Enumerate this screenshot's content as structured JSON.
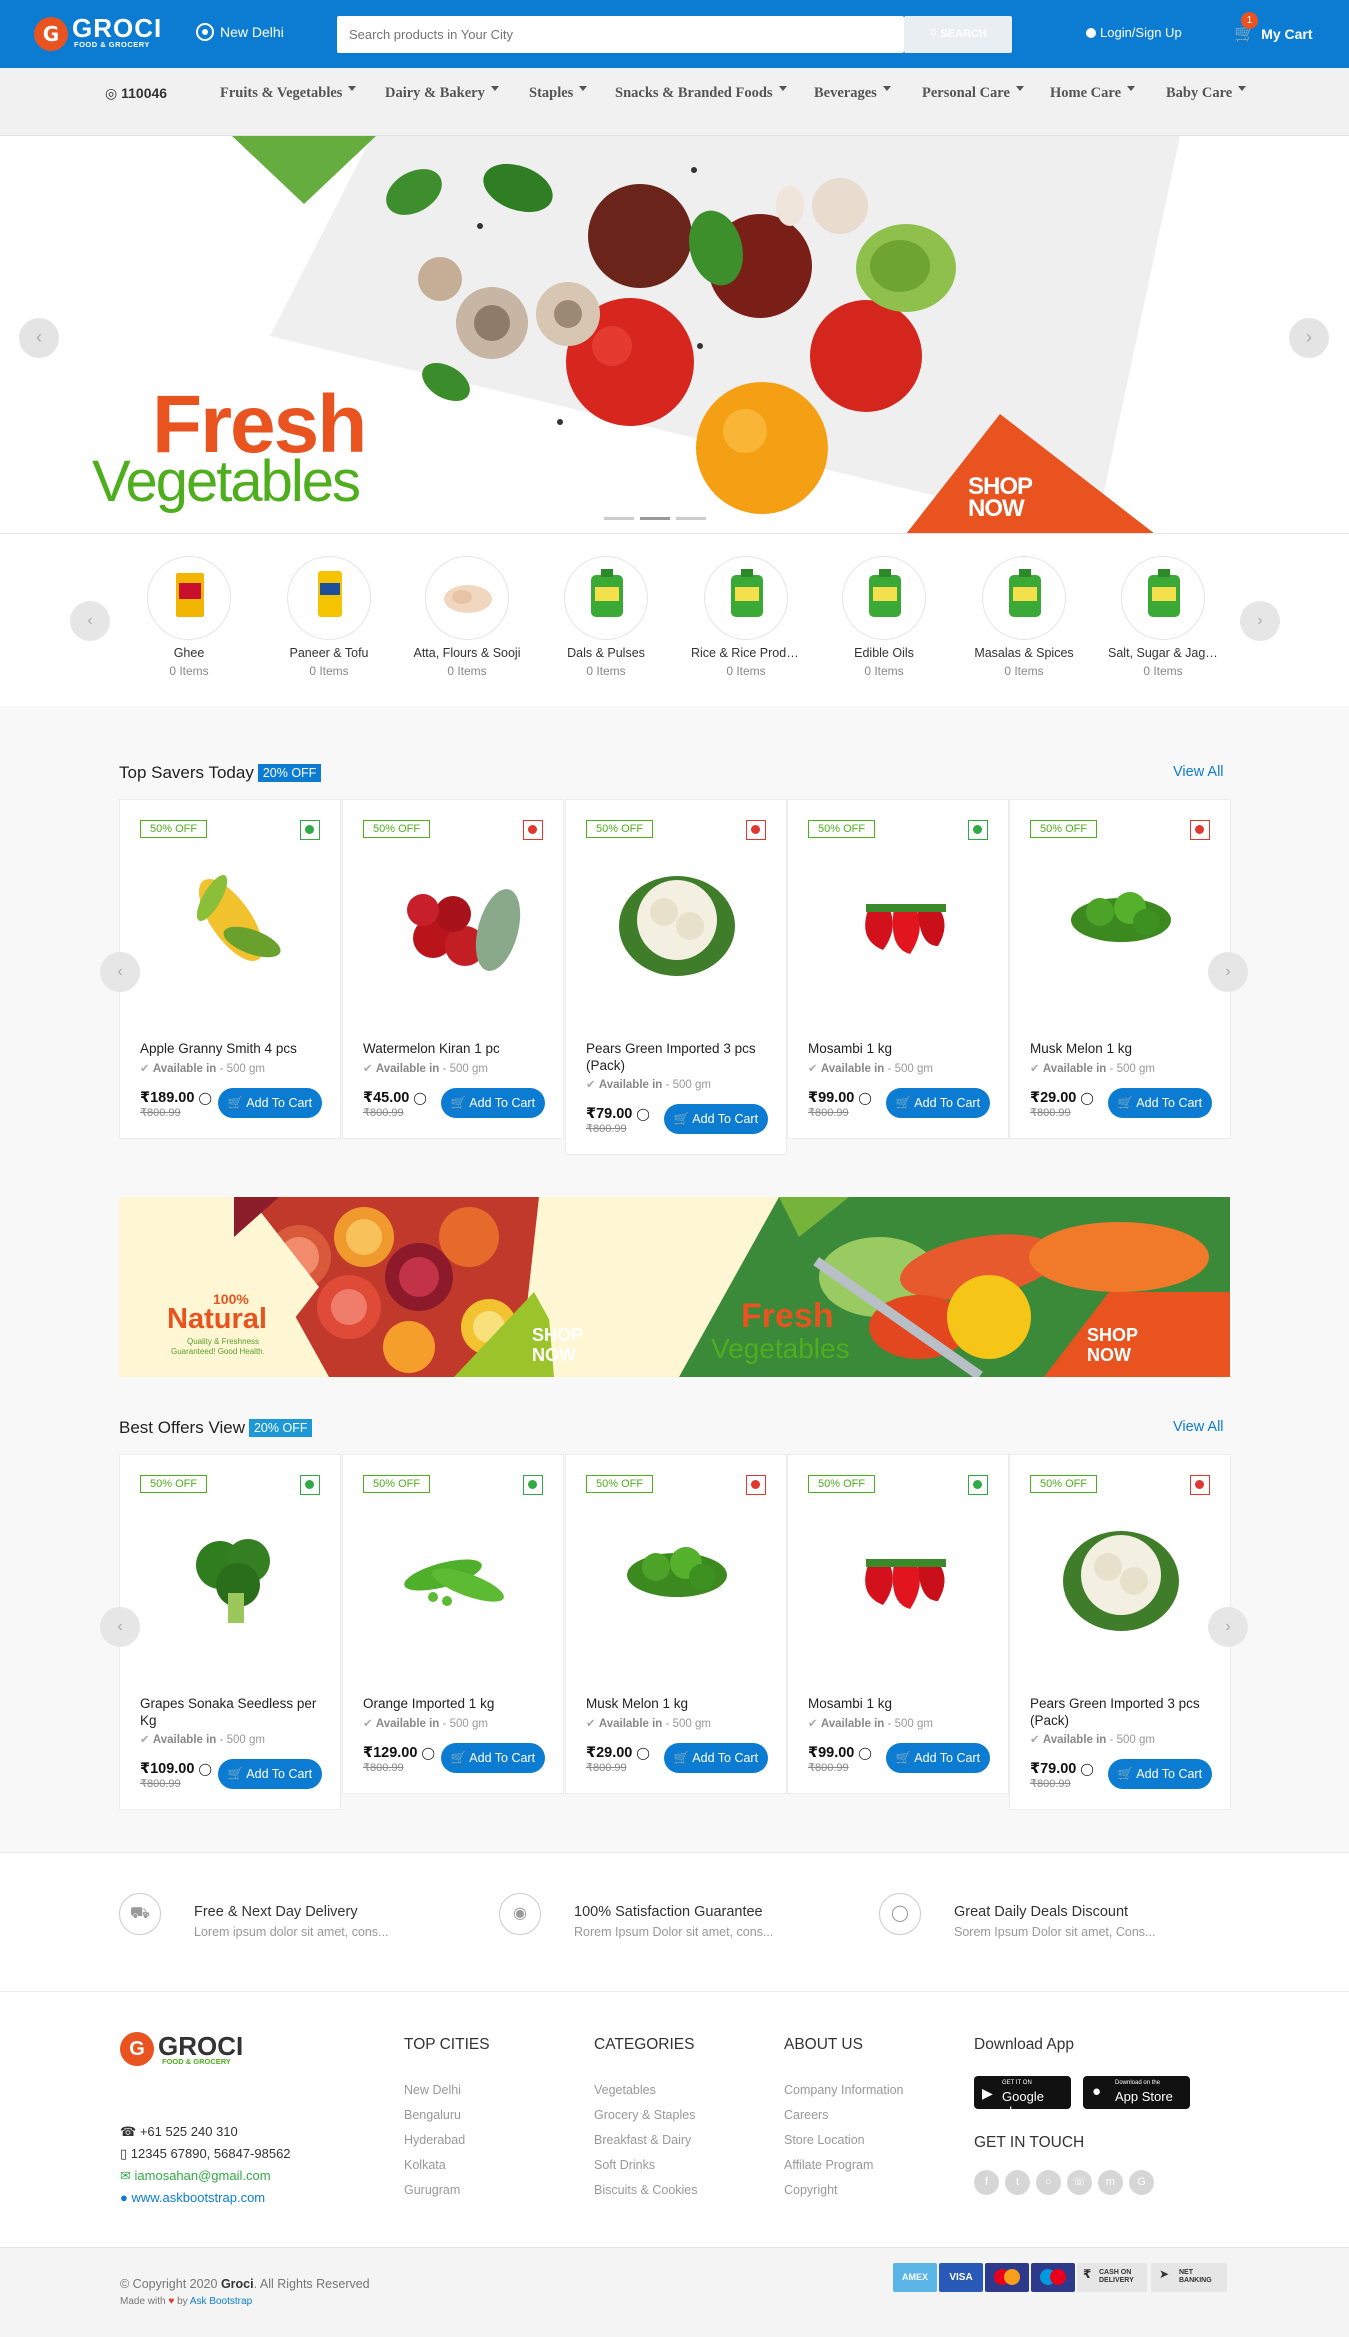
{
  "header": {
    "logo_letter": "G",
    "logo_name": "GROCI",
    "logo_tagline": "FOOD & GROCERY",
    "location": "New Delhi",
    "search_placeholder": "Search products in Your City",
    "search_button": "SEARCH",
    "login": "Login/Sign Up",
    "cart_label": "My Cart",
    "cart_count": "1",
    "brand_color": "#0c7cd3",
    "accent_color": "#e8531f"
  },
  "nav": {
    "pincode": "110046",
    "items": [
      "Fruits & Vegetables",
      "Dairy & Bakery",
      "Staples",
      "Snacks & Branded Foods",
      "Beverages",
      "Personal Care",
      "Home Care",
      "Baby Care"
    ]
  },
  "hero": {
    "title_line1": "Fresh",
    "title_line2": "Vegetables",
    "cta_line1": "SHOP",
    "cta_line2": "NOW",
    "prev_icon": "chevron-left-icon",
    "next_icon": "chevron-right-icon"
  },
  "categories": [
    {
      "name": "Ghee",
      "count": "0 Items"
    },
    {
      "name": "Paneer & Tofu",
      "count": "0 Items"
    },
    {
      "name": "Atta, Flours & Sooji",
      "count": "0 Items"
    },
    {
      "name": "Dals & Pulses",
      "count": "0 Items"
    },
    {
      "name": "Rice & Rice Produ...",
      "count": "0 Items"
    },
    {
      "name": "Edible Oils",
      "count": "0 Items"
    },
    {
      "name": "Masalas & Spices",
      "count": "0 Items"
    },
    {
      "name": "Salt, Sugar & Jagg...",
      "count": "0 Items"
    }
  ],
  "top_savers": {
    "title": "Top Savers Today",
    "badge": "20% OFF",
    "view_all": "View All",
    "products": [
      {
        "discount": "50% OFF",
        "name": "Apple Granny Smith 4 pcs",
        "avail_label": "Available in",
        "avail_value": "- 500 gm",
        "price": "₹189.00",
        "mrp": "₹800.99",
        "cta": "Add To Cart",
        "veg": true
      },
      {
        "discount": "50% OFF",
        "name": "Watermelon Kiran 1 pc",
        "avail_label": "Available in",
        "avail_value": "- 500 gm",
        "price": "₹45.00",
        "mrp": "₹800.99",
        "cta": "Add To Cart",
        "veg": false
      },
      {
        "discount": "50% OFF",
        "name": "Pears Green Imported 3 pcs (Pack)",
        "avail_label": "Available in",
        "avail_value": "- 500 gm",
        "price": "₹79.00",
        "mrp": "₹800.99",
        "cta": "Add To Cart",
        "veg": false
      },
      {
        "discount": "50% OFF",
        "name": "Mosambi 1 kg",
        "avail_label": "Available in",
        "avail_value": "- 500 gm",
        "price": "₹99.00",
        "mrp": "₹800.99",
        "cta": "Add To Cart",
        "veg": true
      },
      {
        "discount": "50% OFF",
        "name": "Musk Melon 1 kg",
        "avail_label": "Available in",
        "avail_value": "- 500 gm",
        "price": "₹29.00",
        "mrp": "₹800.99",
        "cta": "Add To Cart",
        "veg": false
      }
    ]
  },
  "promo": {
    "natural_pct": "100%",
    "natural": "Natural",
    "natural_sub1": "Quality & Freshness",
    "natural_sub2": "Guaranteed! Good Health.",
    "shop1_a": "SHOP",
    "shop1_b": "NOW",
    "fresh": "Fresh",
    "vegetables": "Vegetables",
    "shop2_a": "SHOP",
    "shop2_b": "NOW"
  },
  "best_offers": {
    "title": "Best Offers View",
    "badge": "20% OFF",
    "view_all": "View All",
    "products": [
      {
        "discount": "50% OFF",
        "name": "Grapes Sonaka Seedless per Kg",
        "avail_label": "Available in",
        "avail_value": "- 500 gm",
        "price": "₹109.00",
        "mrp": "₹800.99",
        "cta": "Add To Cart",
        "veg": true
      },
      {
        "discount": "50% OFF",
        "name": "Orange Imported 1 kg",
        "avail_label": "Available in",
        "avail_value": "- 500 gm",
        "price": "₹129.00",
        "mrp": "₹800.99",
        "cta": "Add To Cart",
        "veg": true
      },
      {
        "discount": "50% OFF",
        "name": "Musk Melon 1 kg",
        "avail_label": "Available in",
        "avail_value": "- 500 gm",
        "price": "₹29.00",
        "mrp": "₹800.99",
        "cta": "Add To Cart",
        "veg": false
      },
      {
        "discount": "50% OFF",
        "name": "Mosambi 1 kg",
        "avail_label": "Available in",
        "avail_value": "- 500 gm",
        "price": "₹99.00",
        "mrp": "₹800.99",
        "cta": "Add To Cart",
        "veg": true
      },
      {
        "discount": "50% OFF",
        "name": "Pears Green Imported 3 pcs (Pack)",
        "avail_label": "Available in",
        "avail_value": "- 500 gm",
        "price": "₹79.00",
        "mrp": "₹800.99",
        "cta": "Add To Cart",
        "veg": false
      }
    ]
  },
  "features": [
    {
      "title": "Free & Next Day Delivery",
      "sub": "Lorem ipsum dolor sit amet, cons...",
      "icon": "truck-icon"
    },
    {
      "title": "100% Satisfaction Guarantee",
      "sub": "Rorem Ipsum Dolor sit amet, cons...",
      "icon": "basket-icon"
    },
    {
      "title": "Great Daily Deals Discount",
      "sub": "Sorem Ipsum Dolor sit amet, Cons...",
      "icon": "tag-icon"
    }
  ],
  "footer": {
    "phone1": "+61 525 240 310",
    "phone2": "12345 67890, 56847-98562",
    "email": "iamosahan@gmail.com",
    "website": "www.askbootstrap.com",
    "cities_title": "TOP CITIES",
    "cities": [
      "New Delhi",
      "Bengaluru",
      "Hyderabad",
      "Kolkata",
      "Gurugram"
    ],
    "categories_title": "CATEGORIES",
    "categories": [
      "Vegetables",
      "Grocery & Staples",
      "Breakfast & Dairy",
      "Soft Drinks",
      "Biscuits & Cookies"
    ],
    "about_title": "ABOUT US",
    "about": [
      "Company Information",
      "Careers",
      "Store Location",
      "Affilate Program",
      "Copyright"
    ],
    "app_title": "Download App",
    "google_small": "GET IT ON",
    "google_big": "Google play",
    "apple_small": "Download on the",
    "apple_big": "App Store",
    "touch_title": "GET IN TOUCH",
    "copyright_pre": "© Copyright 2020",
    "copyright_brand": "Groci",
    "copyright_post": ". All Rights Reserved",
    "made_with": "Made with",
    "made_by": "by",
    "made_link": "Ask Bootstrap",
    "payments": [
      "AMEX",
      "VISA",
      "",
      "",
      "CASH ON DELIVERY",
      "NET BANKING"
    ]
  }
}
